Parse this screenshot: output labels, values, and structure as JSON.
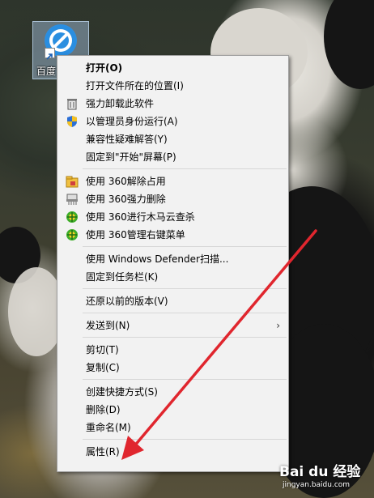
{
  "desktop_icon": {
    "label": "百度"
  },
  "context_menu": {
    "groups": [
      [
        {
          "label": "打开(O)",
          "bold": true,
          "icon": null
        },
        {
          "label": "打开文件所在的位置(I)",
          "icon": null
        },
        {
          "label": "强力卸载此软件",
          "icon": "trash-icon"
        },
        {
          "label": "以管理员身份运行(A)",
          "icon": "uac-shield-icon"
        },
        {
          "label": "兼容性疑难解答(Y)",
          "icon": null
        },
        {
          "label": "固定到\"开始\"屏幕(P)",
          "icon": null
        }
      ],
      [
        {
          "label": "使用 360解除占用",
          "icon": "360-unlock-icon"
        },
        {
          "label": "使用 360强力删除",
          "icon": "360-shred-icon"
        },
        {
          "label": "使用 360进行木马云查杀",
          "icon": "360-scan-icon"
        },
        {
          "label": "使用 360管理右键菜单",
          "icon": "360-menu-icon"
        }
      ],
      [
        {
          "label": "使用 Windows Defender扫描...",
          "icon": null
        },
        {
          "label": "固定到任务栏(K)",
          "icon": null
        }
      ],
      [
        {
          "label": "还原以前的版本(V)",
          "icon": null
        }
      ],
      [
        {
          "label": "发送到(N)",
          "icon": null,
          "submenu": true
        }
      ],
      [
        {
          "label": "剪切(T)",
          "icon": null
        },
        {
          "label": "复制(C)",
          "icon": null
        }
      ],
      [
        {
          "label": "创建快捷方式(S)",
          "icon": null
        },
        {
          "label": "删除(D)",
          "icon": null
        },
        {
          "label": "重命名(M)",
          "icon": null
        }
      ],
      [
        {
          "label": "属性(R)",
          "icon": null
        }
      ]
    ],
    "submenu_glyph": "›"
  },
  "annotation": {
    "color": "#e0262e"
  },
  "watermark": {
    "main": "Bai du 经验",
    "sub": "jingyan.baidu.com"
  }
}
